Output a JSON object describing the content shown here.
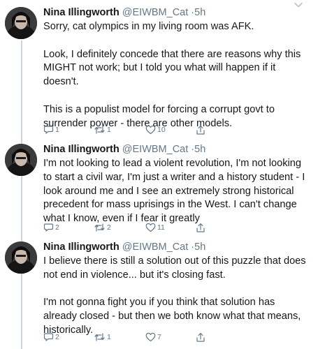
{
  "colors": {
    "text": "#14171a",
    "muted": "#657786",
    "divider": "#e6ecf0",
    "thread_line": "#ccd6dd"
  },
  "tweets": [
    {
      "author": {
        "name": "Nina Illingworth",
        "handle": "@EIWBM_Cat",
        "time": "5h",
        "separator": "·",
        "avatar_icon": "user-avatar"
      },
      "paragraphs": [
        "Sorry, cat olympics in my living room was AFK.",
        "Look, I definitely concede that there are reasons why this MIGHT not work; but I told you what will happen if it doesn't.",
        "This is a populist model for forcing a corrupt govt to surrender power - there are other models."
      ],
      "actions": {
        "reply_count": "1",
        "retweet_count": "1",
        "like_count": "10"
      }
    },
    {
      "author": {
        "name": "Nina Illingworth",
        "handle": "@EIWBM_Cat",
        "time": "5h",
        "separator": "·",
        "avatar_icon": "user-avatar"
      },
      "paragraphs": [
        "I'm not looking to lead a violent revolution, I'm not looking to start a civil war, I'm just a writer and a history student - I look around me and I see an extremely strong historical precedent for mass uprisings in the West. I can't change what I know, even if I fear it greatly"
      ],
      "actions": {
        "reply_count": "2",
        "retweet_count": "2",
        "like_count": "11"
      }
    },
    {
      "author": {
        "name": "Nina Illingworth",
        "handle": "@EIWBM_Cat",
        "time": "5h",
        "separator": "·",
        "avatar_icon": "user-avatar"
      },
      "paragraphs": [
        "I believe there is still a solution out of this puzzle that does not end in violence... but it's closing fast.",
        "I'm not gonna fight you if you think that solution has already closed - but then we both know what that means, historically."
      ],
      "actions": {
        "reply_count": "2",
        "retweet_count": "1",
        "like_count": "7"
      }
    }
  ]
}
